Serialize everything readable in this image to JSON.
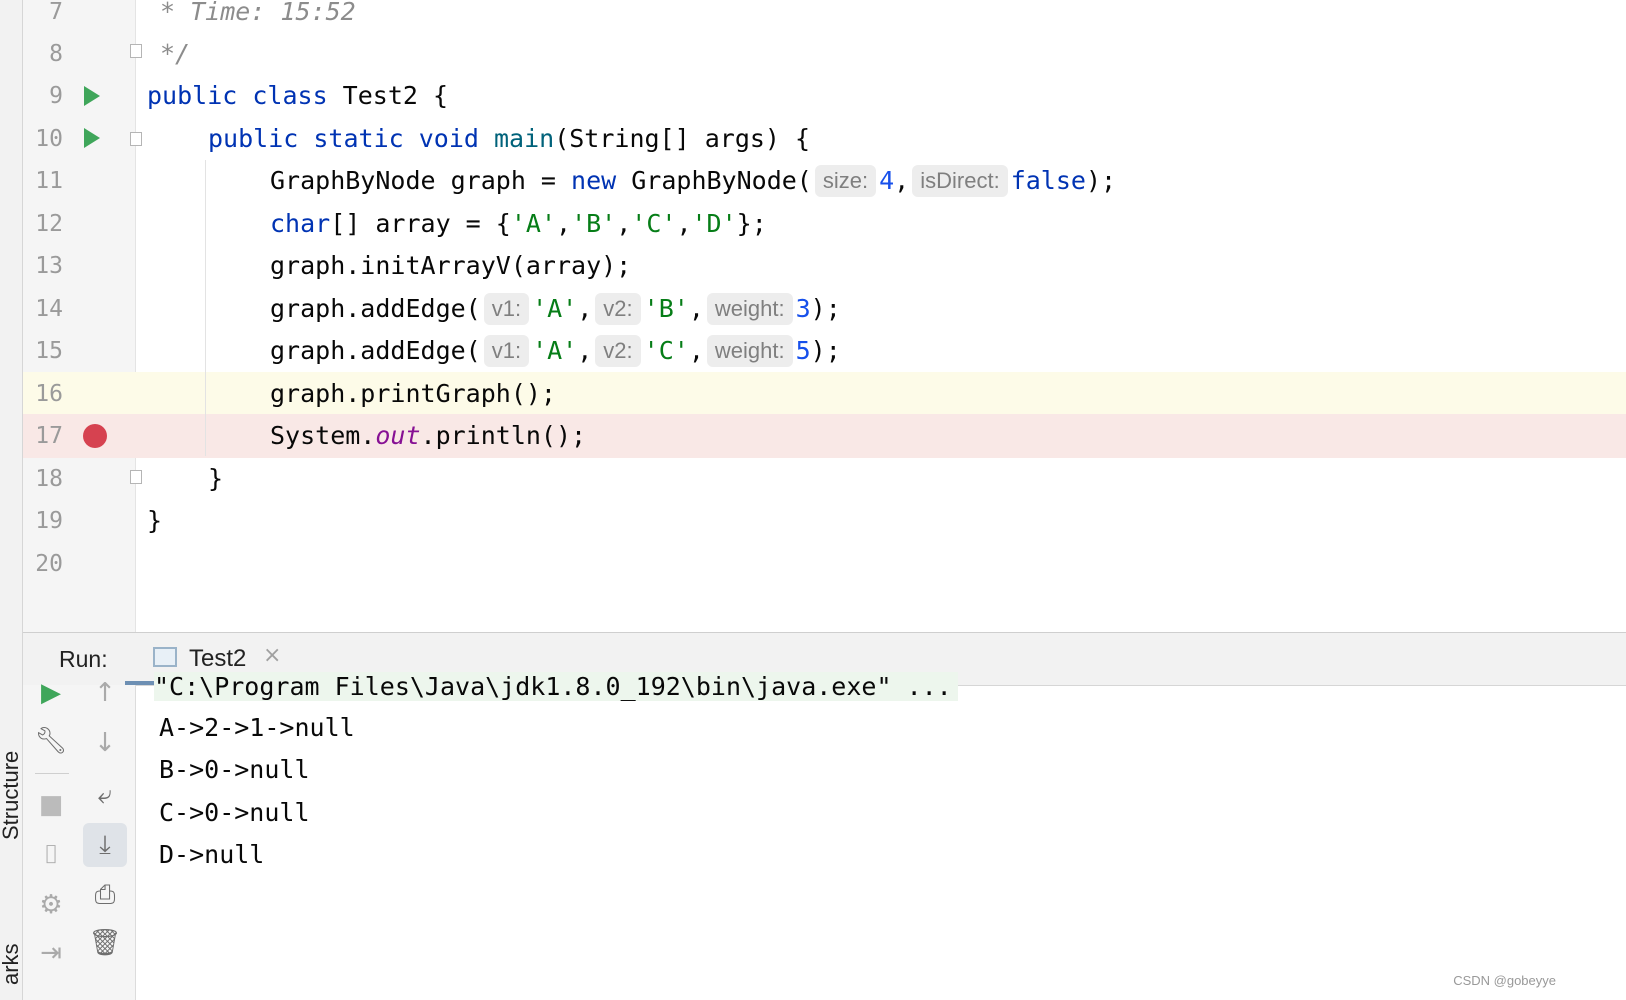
{
  "side_tabs": {
    "structure": "Structure",
    "bookmarks": "arks"
  },
  "editor": {
    "lines": [
      {
        "n": "7"
      },
      {
        "n": "8"
      },
      {
        "n": "9"
      },
      {
        "n": "10"
      },
      {
        "n": "11"
      },
      {
        "n": "12"
      },
      {
        "n": "13"
      },
      {
        "n": "14"
      },
      {
        "n": "15"
      },
      {
        "n": "16"
      },
      {
        "n": "17"
      },
      {
        "n": "18"
      },
      {
        "n": "19"
      },
      {
        "n": "20"
      }
    ],
    "l7": "* Time: 15:52",
    "l8": "*/",
    "l9": {
      "kw": "public class",
      "rest": " Test2 {"
    },
    "l10": {
      "kw": "public static void",
      "name": " main",
      "rest": "(String[] args) {"
    },
    "l11": {
      "a": "GraphByNode graph = ",
      "kw": "new",
      "b": " GraphByNode(",
      "h1": "size:",
      "v1": "4",
      "c": ",",
      "h2": "isDirect:",
      "v2": "false",
      "d": ");"
    },
    "l12": {
      "kw": "char",
      "a": "[] array = {",
      "s1": "'A'",
      "s2": "'B'",
      "s3": "'C'",
      "s4": "'D'",
      "comma": ",",
      "d": "};"
    },
    "l13": "graph.initArrayV(array);",
    "l14": {
      "a": "graph.addEdge(",
      "h1": "v1:",
      "v1": "'A'",
      "h2": "v2:",
      "v2": "'B'",
      "h3": "weight:",
      "v3": "3",
      "comma": ",",
      "d": ");"
    },
    "l15": {
      "a": "graph.addEdge(",
      "h1": "v1:",
      "v1": "'A'",
      "h2": "v2:",
      "v2": "'C'",
      "h3": "weight:",
      "v3": "5",
      "comma": ",",
      "d": ");"
    },
    "l16": "graph.printGraph();",
    "l17": {
      "a": "System.",
      "f": "out",
      "b": ".println();"
    },
    "l18": "}",
    "l19": "}"
  },
  "run_panel": {
    "label": "Run:",
    "tab": "Test2",
    "close": "×",
    "console": [
      "\"C:\\Program Files\\Java\\jdk1.8.0_192\\bin\\java.exe\" ...",
      "A->2->1->null",
      "B->0->null",
      "C->0->null",
      "D->null"
    ]
  },
  "watermark": "CSDN @gobeyye",
  "colors": {
    "keyword": "#0033b3",
    "string": "#067d17",
    "number": "#1750eb",
    "field": "#871094",
    "run": "#3fa65a",
    "breakpoint": "#d64250",
    "current_line": "#fdfbe8",
    "breakpoint_line": "#f9e8e6"
  }
}
